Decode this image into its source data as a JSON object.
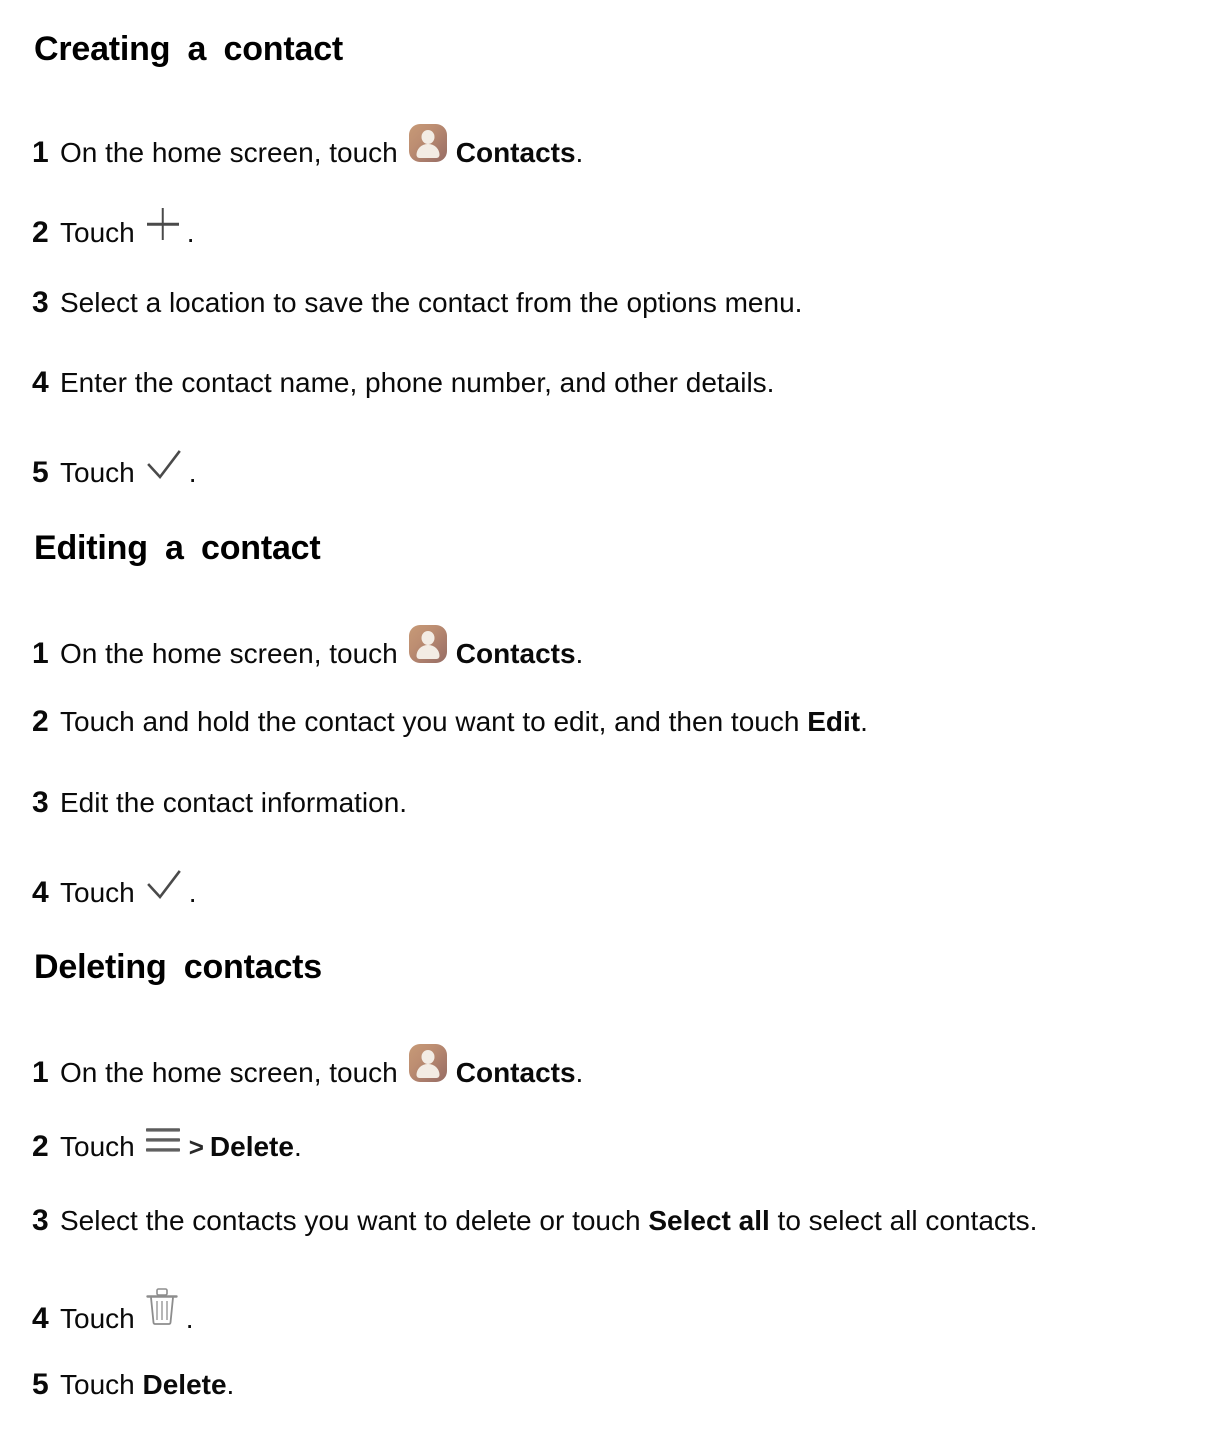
{
  "document": {
    "title": "Contacts help — Creating, Editing, Deleting contacts",
    "background_color": "#ffffff",
    "text_color": "#000000"
  },
  "icons": {
    "contacts_app": {
      "name": "contacts-app-icon",
      "gradient_from": "#c79a77",
      "gradient_to": "#966d64",
      "glyph_color": "#f3ece4"
    },
    "plus": {
      "name": "plus-icon",
      "color": "#4a4a4a"
    },
    "check": {
      "name": "check-icon",
      "color": "#4a4a4a"
    },
    "menu": {
      "name": "hamburger-menu-icon",
      "color": "#4f4f4f"
    },
    "trash": {
      "name": "trash-icon",
      "color": "#8a8a8a"
    }
  },
  "sections": [
    {
      "id": "creating",
      "heading": "Creating a contact",
      "steps": [
        {
          "number": "1",
          "parts": [
            {
              "kind": "text",
              "value": "On the home screen, touch"
            },
            {
              "kind": "icon",
              "value": "contacts-app-icon"
            },
            {
              "kind": "bold",
              "value": "Contacts"
            },
            {
              "kind": "text",
              "value": "."
            }
          ],
          "plain": "On the home screen, touch Contacts."
        },
        {
          "number": "2",
          "parts": [
            {
              "kind": "text",
              "value": "Touch"
            },
            {
              "kind": "icon",
              "value": "plus-icon"
            },
            {
              "kind": "text",
              "value": "."
            }
          ],
          "plain": "Touch +."
        },
        {
          "number": "3",
          "parts": [
            {
              "kind": "text",
              "value": "Select a location to save the contact from the options menu."
            }
          ],
          "plain": "Select a location to save the contact from the options menu."
        },
        {
          "number": "4",
          "parts": [
            {
              "kind": "text",
              "value": "Enter the contact name, phone number, and other details."
            }
          ],
          "plain": "Enter the contact name, phone number, and other details."
        },
        {
          "number": "5",
          "parts": [
            {
              "kind": "text",
              "value": "Touch"
            },
            {
              "kind": "icon",
              "value": "check-icon"
            },
            {
              "kind": "text",
              "value": "."
            }
          ],
          "plain": "Touch ✓."
        }
      ]
    },
    {
      "id": "editing",
      "heading": "Editing a contact",
      "steps": [
        {
          "number": "1",
          "parts": [
            {
              "kind": "text",
              "value": "On the home screen, touch"
            },
            {
              "kind": "icon",
              "value": "contacts-app-icon"
            },
            {
              "kind": "bold",
              "value": "Contacts"
            },
            {
              "kind": "text",
              "value": "."
            }
          ],
          "plain": "On the home screen, touch Contacts."
        },
        {
          "number": "2",
          "parts": [
            {
              "kind": "text",
              "value": "Touch and hold the contact you want to edit, and then touch"
            },
            {
              "kind": "bold",
              "value": "Edit"
            },
            {
              "kind": "text",
              "value": "."
            }
          ],
          "plain": "Touch and hold the contact you want to edit, and then touch Edit."
        },
        {
          "number": "3",
          "parts": [
            {
              "kind": "text",
              "value": "Edit the contact information."
            }
          ],
          "plain": "Edit the contact information."
        },
        {
          "number": "4",
          "parts": [
            {
              "kind": "text",
              "value": "Touch"
            },
            {
              "kind": "icon",
              "value": "check-icon"
            },
            {
              "kind": "text",
              "value": "."
            }
          ],
          "plain": "Touch ✓."
        }
      ]
    },
    {
      "id": "deleting",
      "heading": "Deleting contacts",
      "steps": [
        {
          "number": "1",
          "parts": [
            {
              "kind": "text",
              "value": "On the home screen, touch"
            },
            {
              "kind": "icon",
              "value": "contacts-app-icon"
            },
            {
              "kind": "bold",
              "value": "Contacts"
            },
            {
              "kind": "text",
              "value": "."
            }
          ],
          "plain": "On the home screen, touch Contacts."
        },
        {
          "number": "2",
          "parts": [
            {
              "kind": "text",
              "value": "Touch"
            },
            {
              "kind": "icon",
              "value": "hamburger-menu-icon"
            },
            {
              "kind": "separator",
              "value": ">"
            },
            {
              "kind": "bold",
              "value": "Delete"
            },
            {
              "kind": "text",
              "value": "."
            }
          ],
          "plain": "Touch ≡ > Delete."
        },
        {
          "number": "3",
          "parts": [
            {
              "kind": "text",
              "value": "Select the contacts you want to delete or touch"
            },
            {
              "kind": "bold",
              "value": "Select all"
            },
            {
              "kind": "text",
              "value": "to select all contacts."
            }
          ],
          "plain": "Select the contacts you want to delete or touch Select all to select all contacts."
        },
        {
          "number": "4",
          "parts": [
            {
              "kind": "text",
              "value": "Touch"
            },
            {
              "kind": "icon",
              "value": "trash-icon"
            },
            {
              "kind": "text",
              "value": "."
            }
          ],
          "plain": "Touch 🗑."
        },
        {
          "number": "5",
          "parts": [
            {
              "kind": "text",
              "value": "Touch"
            },
            {
              "kind": "bold",
              "value": "Delete"
            },
            {
              "kind": "text",
              "value": "."
            }
          ],
          "plain": "Touch Delete."
        }
      ]
    }
  ],
  "labels": {
    "step1_prefix": "On the home screen, touch",
    "contacts_word": "Contacts",
    "touch_word": "Touch",
    "period": ".",
    "gt": ">",
    "edit_word": "Edit",
    "delete_word": "Delete",
    "select_all_word": "Select all",
    "step2_edit_prefix": "Touch and hold the contact you want to edit, and then touch",
    "step3_creating": "Select a location to save the contact from the options menu.",
    "step4_creating": "Enter the contact name, phone number, and other details.",
    "step3_editing": "Edit the contact information.",
    "step3_deleting_prefix": "Select the contacts you want to delete or touch",
    "step3_deleting_suffix": "to select all contacts."
  }
}
